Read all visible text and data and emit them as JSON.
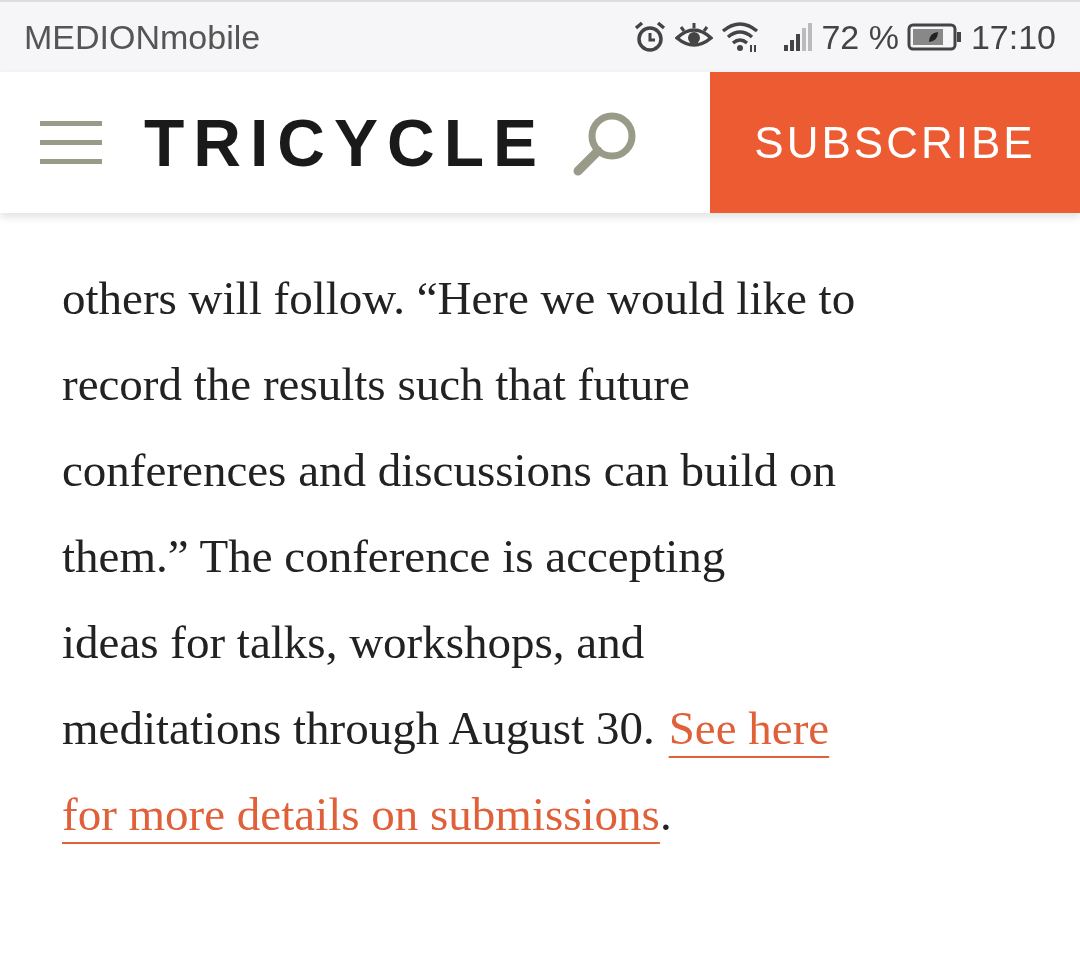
{
  "status_bar": {
    "carrier": "MEDIONmobile",
    "battery": "72 %",
    "time": "17:10"
  },
  "header": {
    "logo": "TRICYCLE",
    "subscribe": "SUBSCRIBE"
  },
  "article": {
    "lines": [
      [
        {
          "kind": "text",
          "text": "others will follow. “Here we would like to"
        }
      ],
      [
        {
          "kind": "text",
          "text": "record the results such that future"
        }
      ],
      [
        {
          "kind": "text",
          "text": "conferences and discussions can build on"
        }
      ],
      [
        {
          "kind": "text",
          "text": "them.” The conference is accepting"
        }
      ],
      [
        {
          "kind": "text",
          "text": "ideas for talks, workshops, and"
        }
      ],
      [
        {
          "kind": "text",
          "text": "meditations through August 30."
        },
        {
          "kind": "link",
          "text": "See here"
        }
      ],
      [
        {
          "kind": "link",
          "text": "for more details on submissions"
        },
        {
          "kind": "text",
          "text": "."
        }
      ]
    ]
  }
}
